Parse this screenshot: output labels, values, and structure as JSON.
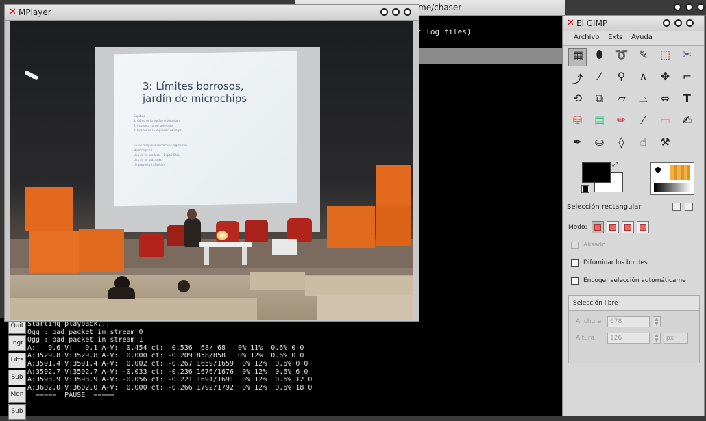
{
  "terminal": {
    "title": "me/chaser",
    "line": "t log files)"
  },
  "mplayer": {
    "title": "MPlayer",
    "slide": {
      "heading_line1": "3: Límites borrosos,",
      "heading_line2": "jardín de microchips",
      "body_block1": "Capítulo\n1. Cómo de la equipo ordenador s\n2. Imprenta con el ordenador\n3. Limites de la impresión de chips",
      "body_block2": "En las máquinas microchips digital con\nMicrochips s.l\nUna de mi producto - Digital Chip\nUna de mi ordenador\nUn proyecto (.chip/de)"
    }
  },
  "console": {
    "buttons": [
      "Quit",
      "Ingr",
      "Lifts",
      "Sub",
      "Men",
      "Sub"
    ],
    "lines": [
      "Starting playback...",
      "Ogg : bad packet in stream 0",
      "Ogg : bad packet in stream 1",
      "A:   9.6 V:   9.1 A-V:  0.454 ct:  0.536  68/ 68   0% 11%  0.6% 0 0",
      "A:3529.8 V:3529.8 A-V:  0.000 ct: -0.209 858/858   0% 12%  0.6% 0 0",
      "A:3591.4 V:3591.4 A-V:  0.002 ct: -0.267 1659/1659  0% 12%  0.6% 0 0",
      "A:3592.7 V:3592.7 A-V: -0.033 ct: -0.236 1676/1676  0% 12%  0.6% 6 0",
      "A:3593.9 V:3593.9 A-V: -0.056 ct: -0.221 1691/1691  0% 12%  0.6% 12 0",
      "A:3602.0 V:3602.0 A-V:  0.000 ct: -0.266 1792/1792  0% 12%  0.6% 18 0",
      "  =====  PAUSE  ====="
    ]
  },
  "gimp": {
    "title": "El GIMP",
    "menu": [
      "Archivo",
      "Exts",
      "Ayuda"
    ],
    "tools": [
      "rect-select-icon",
      "ellipse-select-icon",
      "lasso-icon",
      "fuzzy-select-icon",
      "color-select-icon",
      "scissors-icon",
      "paths-icon",
      "color-picker-icon",
      "zoom-icon",
      "measure-icon",
      "move-icon",
      "crop-icon",
      "rotate-icon",
      "scale-icon",
      "shear-icon",
      "perspective-icon",
      "flip-icon",
      "text-icon",
      "bucket-fill-icon",
      "blend-icon",
      "pencil-icon",
      "paintbrush-icon",
      "eraser-icon",
      "airbrush-icon",
      "ink-icon",
      "clone-icon",
      "blur-icon",
      "smudge-icon",
      "dodge-burn-icon"
    ],
    "panel": {
      "title": "Selección rectangular",
      "mode_label": "Modo:",
      "antialias": "Alisado",
      "feather": "Difuminar los bordes",
      "autoshrink": "Encoger selección automáticame",
      "free_selection": "Selección libre",
      "width_label": "Anchura",
      "width_value": "678",
      "height_label": "Altura",
      "height_value": "126",
      "unit": "px"
    }
  }
}
